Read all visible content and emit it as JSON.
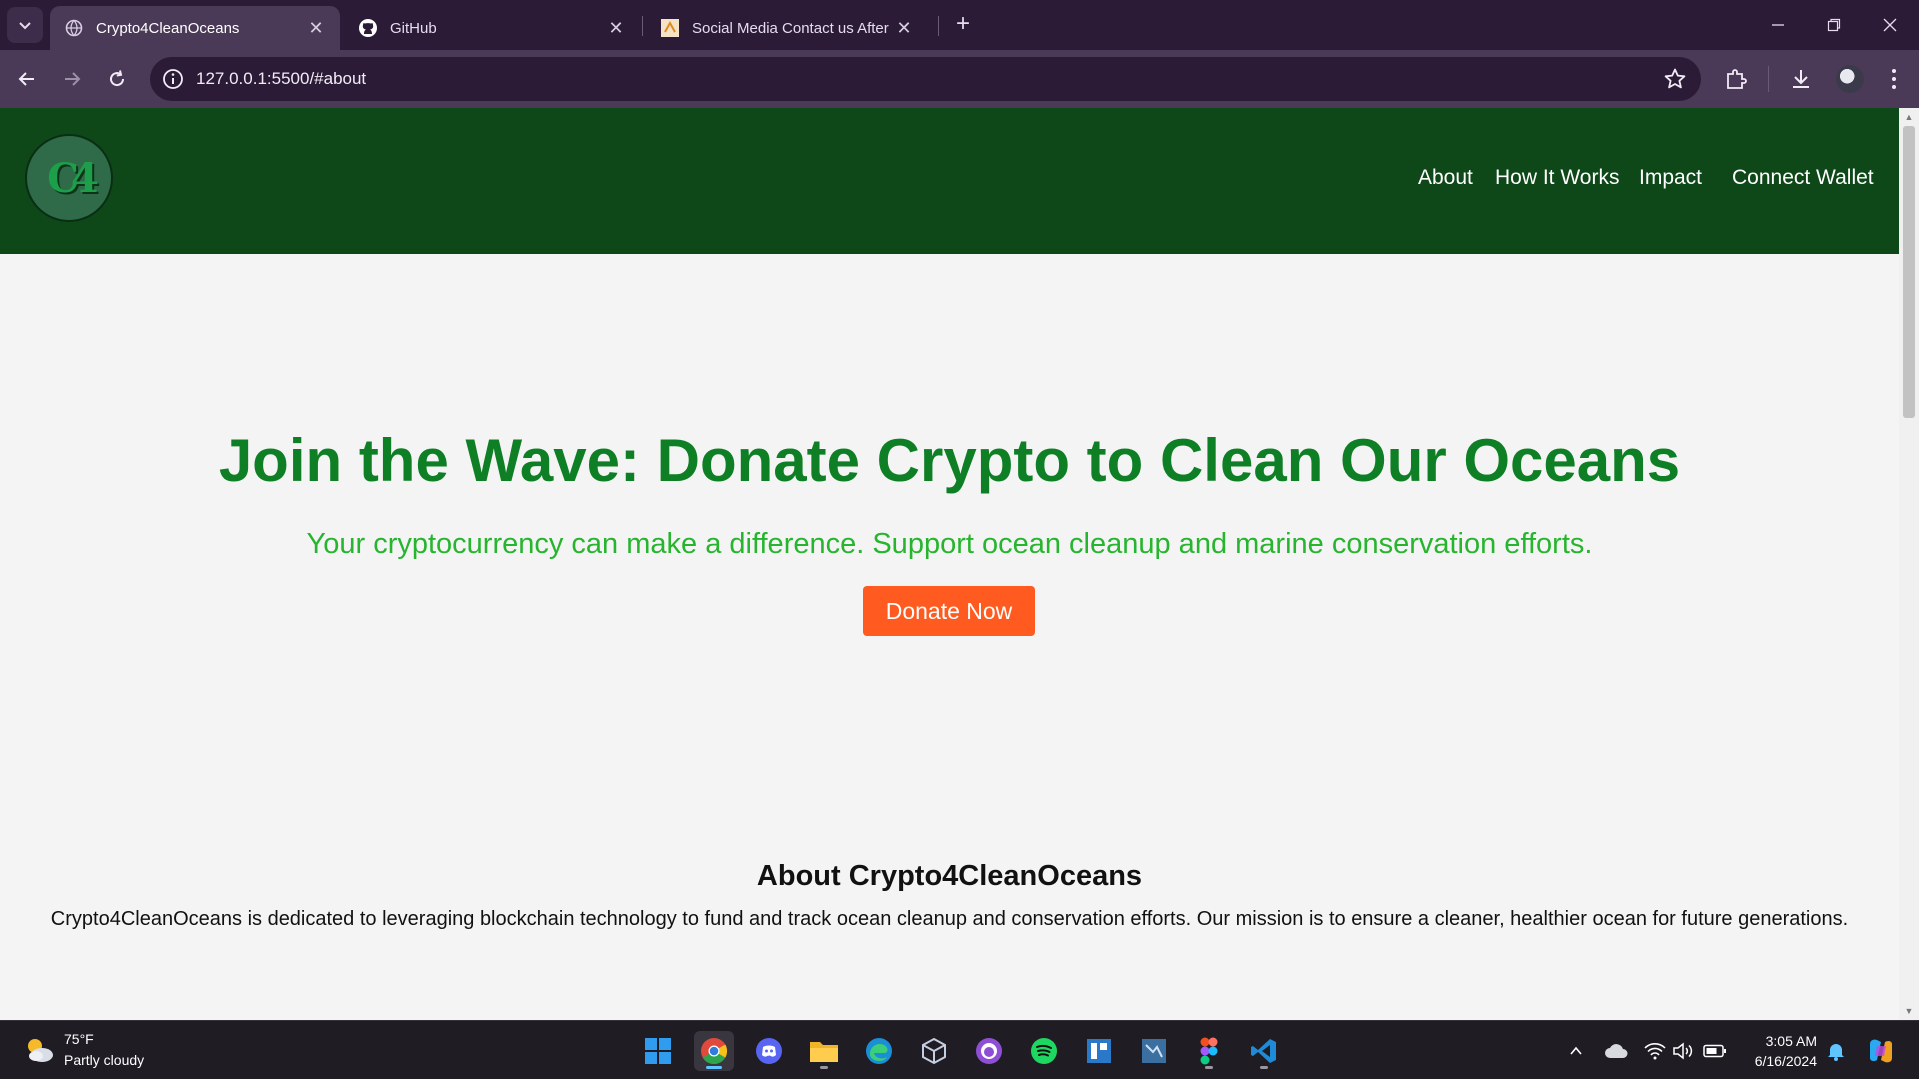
{
  "browser": {
    "tabs": [
      {
        "title": "Crypto4CleanOceans",
        "active": true
      },
      {
        "title": "GitHub",
        "active": false
      },
      {
        "title": "Social Media Contact us After E",
        "active": false
      }
    ],
    "url": "127.0.0.1:5500/#about"
  },
  "site": {
    "logo_text": "C4",
    "nav": {
      "about": "About",
      "how_it_works": "How It Works",
      "impact": "Impact",
      "connect_wallet": "Connect Wallet"
    },
    "hero": {
      "title": "Join the Wave: Donate Crypto to Clean Our Oceans",
      "subtitle": "Your cryptocurrency can make a difference. Support ocean cleanup and marine conservation efforts.",
      "cta": "Donate Now"
    },
    "about": {
      "title": "About Crypto4CleanOceans",
      "text": "Crypto4CleanOceans is dedicated to leveraging blockchain technology to fund and track ocean cleanup and conservation efforts. Our mission is to ensure a cleaner, healthier ocean for future generations."
    },
    "colors": {
      "header_bg": "#0e4718",
      "hero_title": "#0e7f24",
      "hero_subtitle": "#27b52f",
      "cta_bg": "#ff5a1f"
    }
  },
  "taskbar": {
    "weather": {
      "temp": "75°F",
      "desc": "Partly cloudy"
    },
    "apps": [
      "windows-start",
      "chrome",
      "discord",
      "file-explorer",
      "edge",
      "virtualbox",
      "github-desktop",
      "spotify",
      "app-tile",
      "mysql-workbench",
      "figma",
      "vscode"
    ],
    "clock": {
      "time": "3:05 AM",
      "date": "6/16/2024"
    }
  }
}
